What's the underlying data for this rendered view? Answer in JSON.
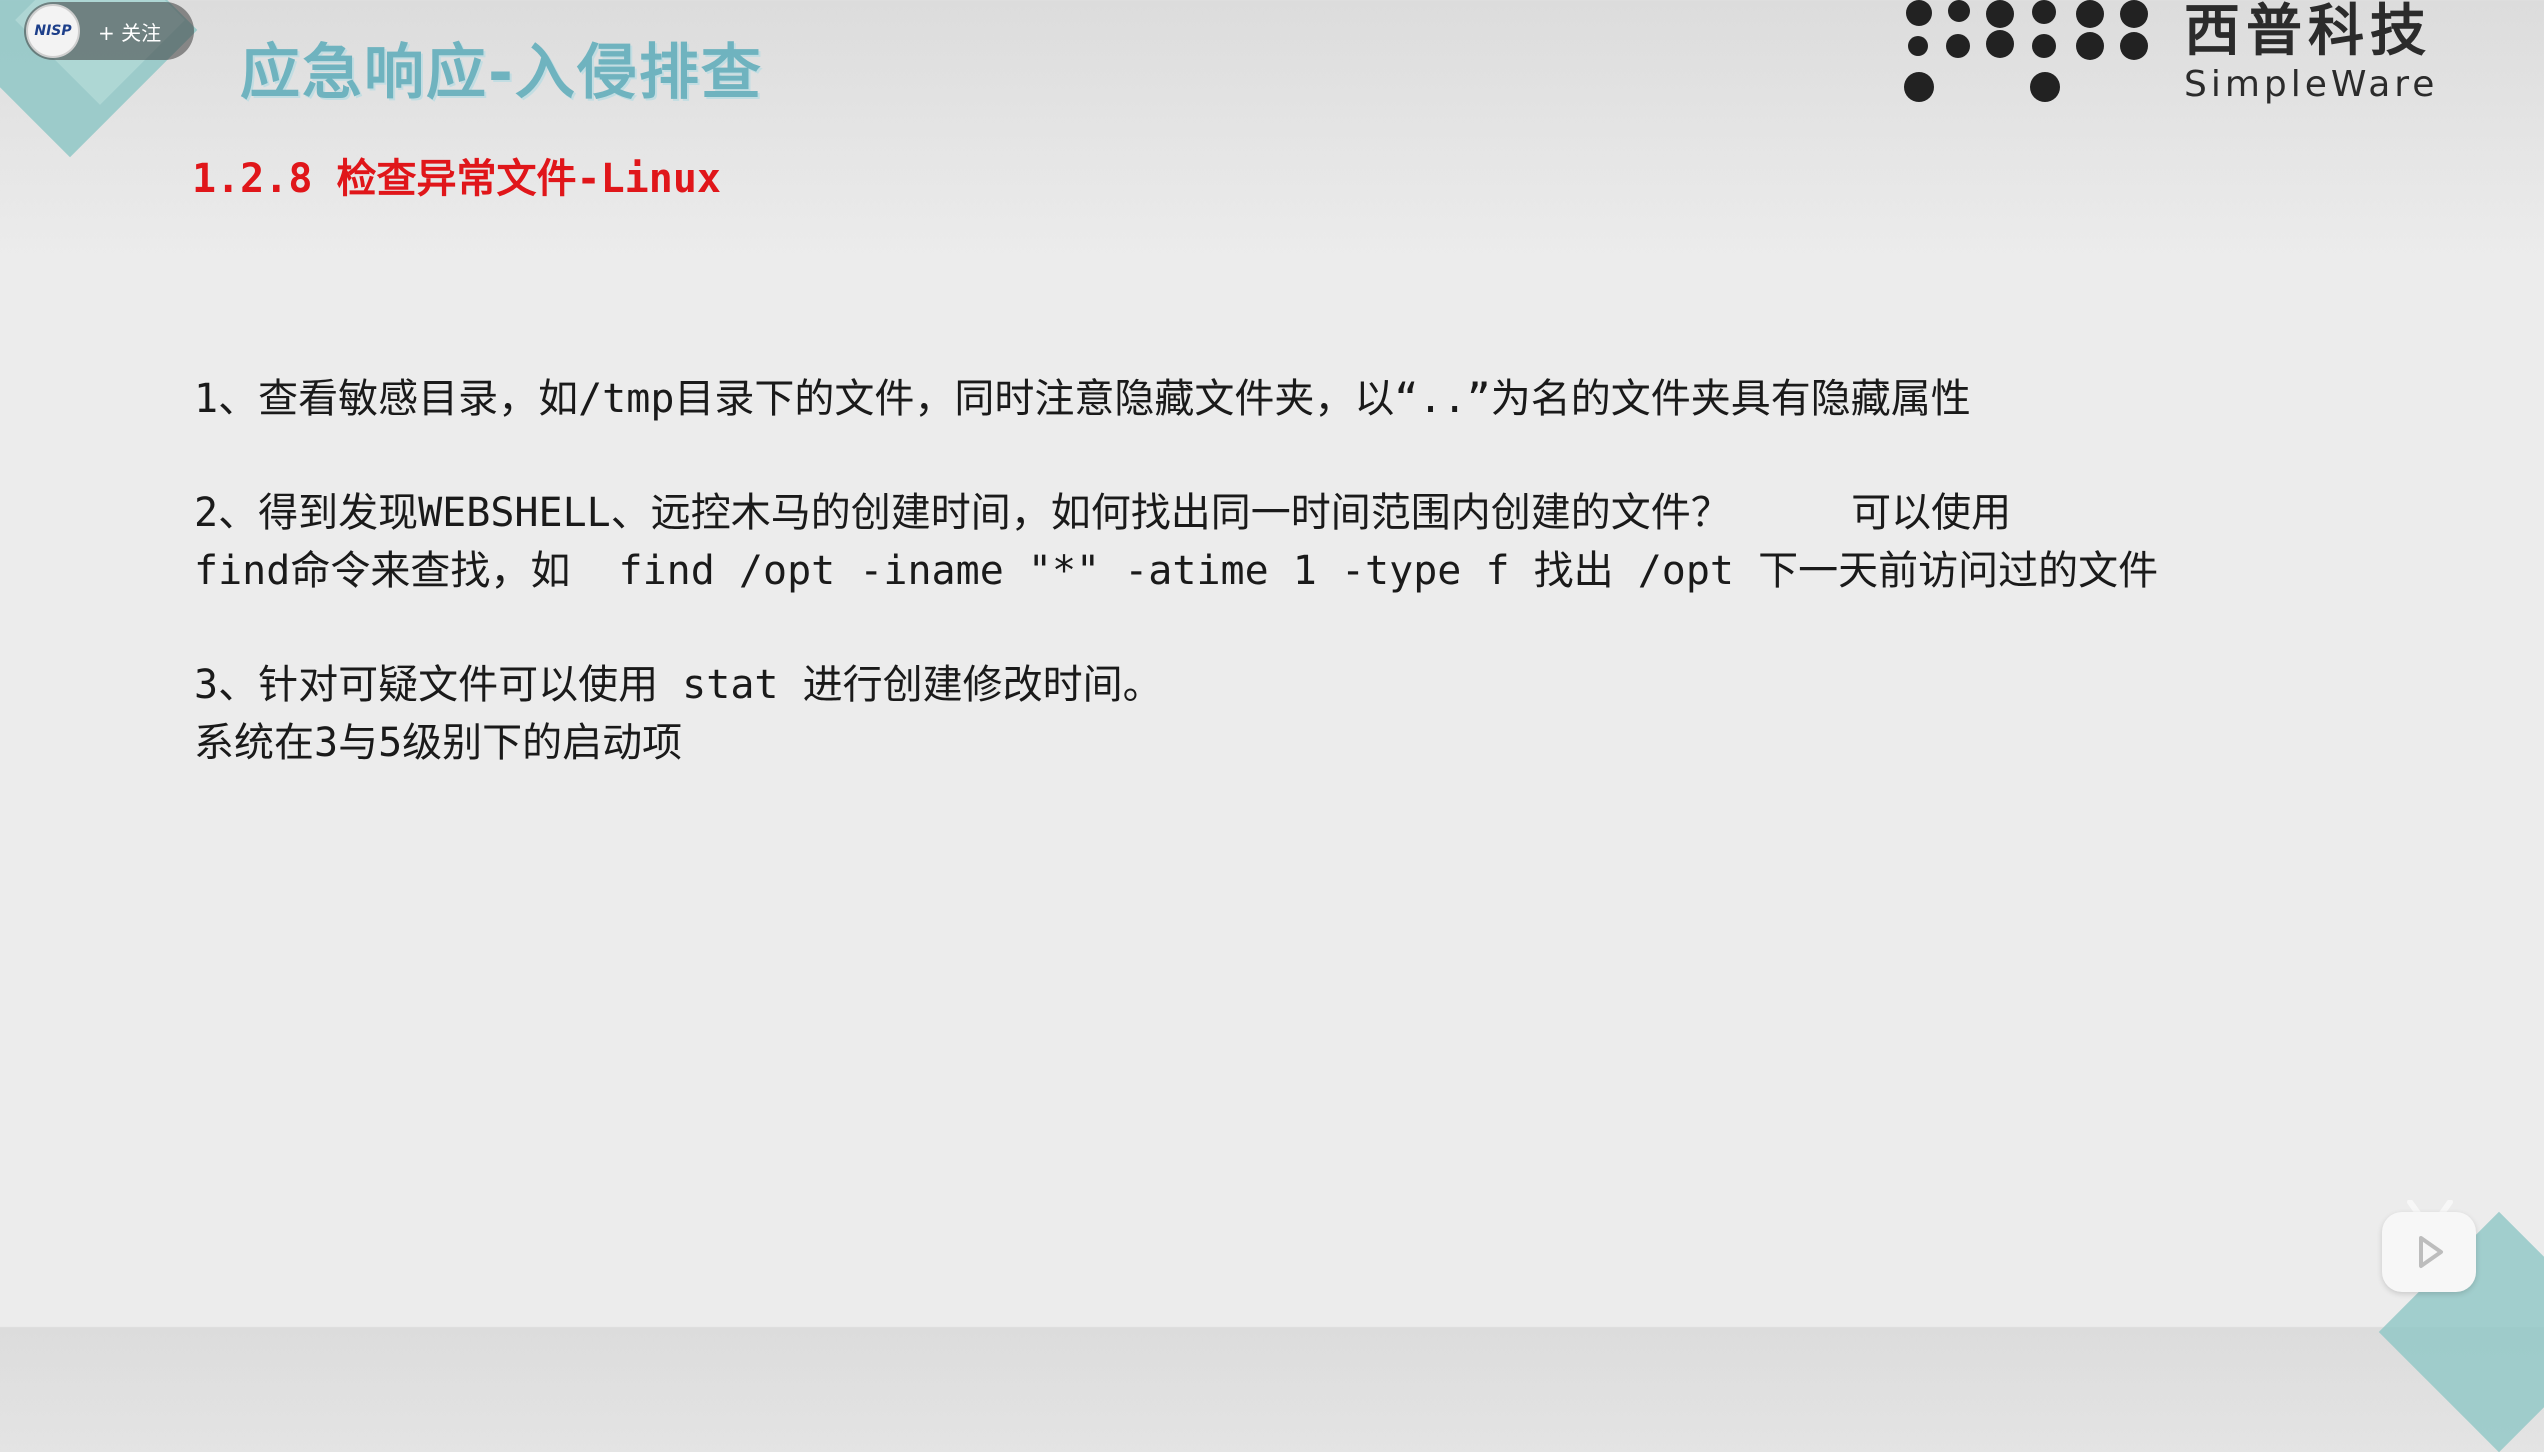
{
  "header": {
    "channel_avatar_text": "NISP",
    "follow_label": "+ 关注",
    "title": "应急响应-入侵排查"
  },
  "logo": {
    "brand_cn": "西普科技",
    "brand_en": "SimpleWare"
  },
  "section": {
    "heading": "1.2.8 检查异常文件-Linux"
  },
  "body": {
    "line1": "1、查看敏感目录，如/tmp目录下的文件，同时注意隐藏文件夹，以“..”为名的文件夹具有隐藏属性",
    "line2a": "2、得到发现WEBSHELL、远控木马的创建时间，如何找出同一时间范围内创建的文件？     可以使用",
    "line2b": "find命令来查找，如  find /opt -iname \"*\" -atime 1 -type f 找出 /opt 下一天前访问过的文件",
    "line3a": "3、针对可疑文件可以使用 stat 进行创建修改时间。",
    "line3b": "系统在3与5级别下的启动项"
  },
  "player": {
    "play_icon": "play-icon"
  }
}
